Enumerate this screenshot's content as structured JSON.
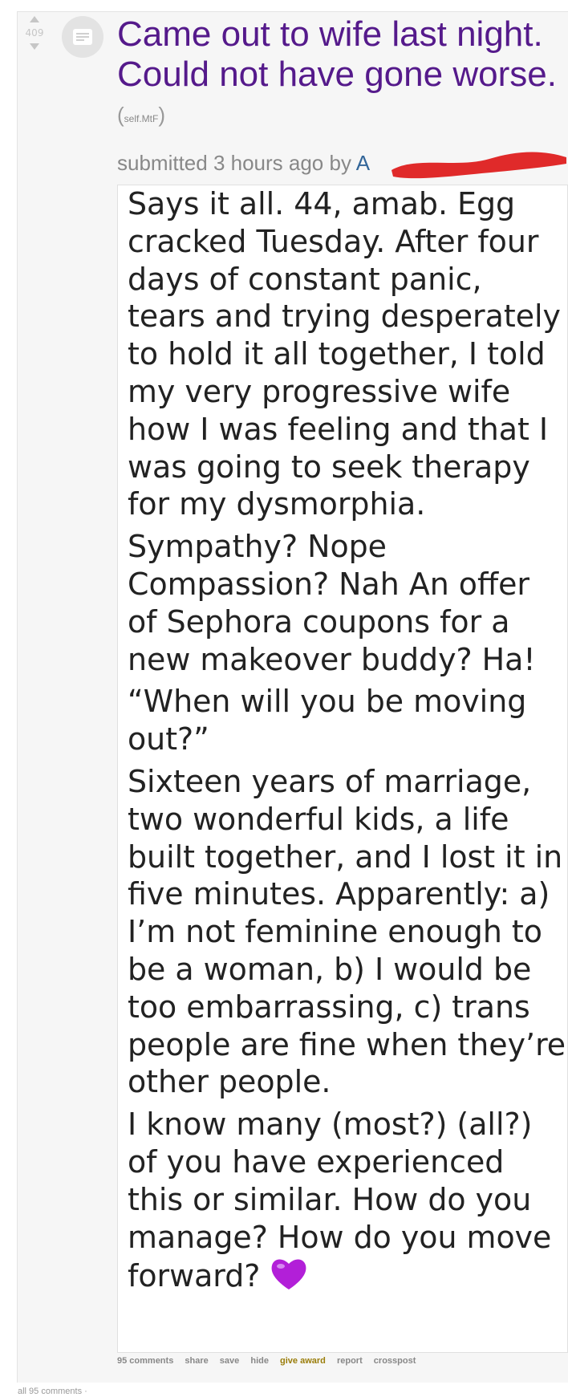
{
  "vote": {
    "score": "409"
  },
  "post": {
    "title": "Came out to wife last night. Could not have gone worse.",
    "domain": "self.MtF",
    "tagline_prefix": "submitted 3 hours ago by",
    "author_visible": "A"
  },
  "body": {
    "paragraphs": [
      "Says it all. 44, amab. Egg cracked Tuesday. After four days of constant panic, tears and trying desperately to hold it all together, I told my very progressive wife how I was feeling and that I was going to seek therapy for my dysmorphia.",
      "Sympathy? Nope Compassion? Nah An offer of Sephora coupons for a new makeover buddy? Ha!",
      "“When will you be moving out?”",
      "Sixteen years of marriage, two wonderful kids, a life built together, and I lost it in five minutes. Apparently: a) I’m not feminine enough to be a woman, b) I would be too embarrassing, c) trans people are fine when they’re other people.",
      "I know many (most?) (all?) of you have experienced this or similar. How do you manage? How do you move forward?"
    ],
    "emoji": "purple-heart-icon"
  },
  "buttons": {
    "comments": "95 comments",
    "share": "share",
    "save": "save",
    "hide": "hide",
    "give_award": "give award",
    "report": "report",
    "crosspost": "crosspost"
  },
  "footer": {
    "all_comments": "all 95 comments ·"
  },
  "colors": {
    "title": "#551a8b",
    "author": "#336699",
    "gold": "#9a7d0a",
    "redaction": "#e02a2a"
  }
}
